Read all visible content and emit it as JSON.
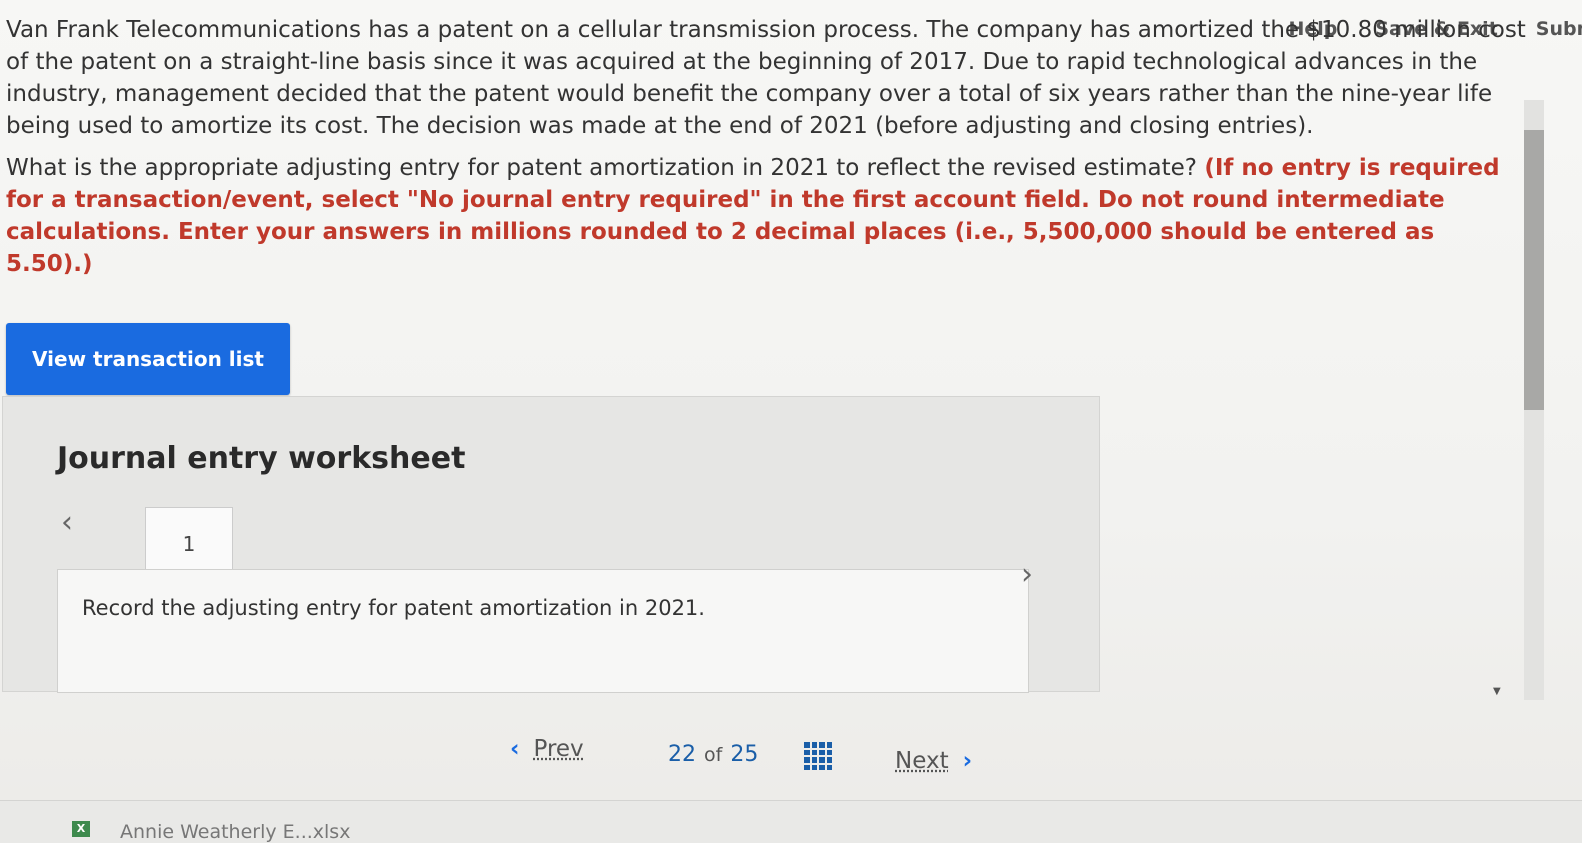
{
  "nav": {
    "help": "Help",
    "save_exit": "Save & Exit",
    "submit": "Submit"
  },
  "question": {
    "p1": "Van Frank Telecommunications has a patent on a cellular transmission process. The company has amortized the $10.80 million cost of the patent on a straight-line basis since it was acquired at the beginning of 2017. Due to rapid technological advances in the industry, management decided that the patent would benefit the company over a total of six years rather than the nine-year life being used to amortize its cost. The decision was made at the end of 2021 (before adjusting and closing entries).",
    "p2_plain": "What is the appropriate adjusting entry for patent amortization in 2021 to reflect the revised estimate? ",
    "p2_red": "(If no entry is required for a transaction/event, select \"No journal entry required\" in the first account field. Do not round intermediate calculations. Enter your answers in millions rounded to 2 decimal places (i.e., 5,500,000 should be entered as 5.50).)"
  },
  "view_transaction_list": "View transaction list",
  "worksheet": {
    "title": "Journal entry worksheet",
    "tab_number": "1",
    "instruction": "Record the adjusting entry for patent amortization in 2021."
  },
  "footer": {
    "prev": "Prev",
    "current": "22",
    "of": "of",
    "total": "25",
    "next": "Next"
  },
  "taskbar": {
    "file_label": "Annie Weatherly E...xlsx"
  }
}
